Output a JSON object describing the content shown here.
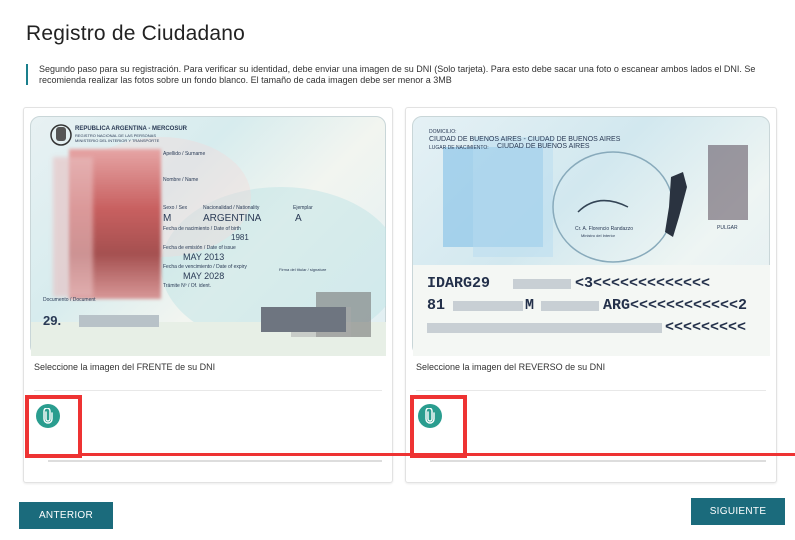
{
  "page": {
    "title": "Registro de Ciudadano",
    "info": "Segundo paso para su registración. Para verificar su identidad, debe enviar una imagen de su DNI (Solo tarjeta). Para esto debe sacar una foto o escanear ambos lados el DNI. Se recomienda realizar las fotos sobre un fondo blanco. El tamaño de cada imagen debe ser menor a 3MB"
  },
  "front_card": {
    "label": "Seleccione la imagen del FRENTE de su DNI",
    "attach_icon": "paperclip-icon",
    "id": {
      "header1": "REPUBLICA ARGENTINA - MERCOSUR",
      "header2": "REGISTRO NACIONAL DE LAS PERSONAS",
      "header3": "MINISTERIO DEL INTERIOR Y TRANSPORTE",
      "apellido_label": "Apellido / Surname",
      "nombre_label": "Nombre / Name",
      "sexo_label": "Sexo / Sex",
      "nacionalidad_label": "Nacionalidad / Nationality",
      "ejemplar_label": "Ejemplar",
      "sexo": "M",
      "nacionalidad": "ARGENTINA",
      "ejemplar": "A",
      "nacimiento_label": "Fecha de nacimiento / Date of birth",
      "nacimiento": "1981",
      "emision_label": "Fecha de emisión / Date of issue",
      "emision": "MAY 2013",
      "vencimiento_label": "Fecha de vencimiento / Date of expiry",
      "vencimiento": "MAY 2028",
      "tramite_label": "Trámite Nº / Of. ident.",
      "documento_label": "Documento / Document",
      "documento": "29.",
      "firma_label": "Firma del titular / signature"
    }
  },
  "back_card": {
    "label": "Seleccione la imagen del REVERSO de su DNI",
    "attach_icon": "paperclip-icon",
    "id": {
      "domicilio_label": "DOMICILIO:",
      "domicilio": "CIUDAD DE BUENOS AIRES - CIUDAD DE BUENOS AIRES",
      "nacimiento_label": "LUGAR DE NACIMIENTO:",
      "nacimiento": "CIUDAD DE BUENOS AIRES",
      "official": "Cr. A. Florencio Randazzo",
      "official_title": "Ministro del Interior",
      "pulgar": "PULGAR",
      "mrz1a": "IDARG29",
      "mrz1b": "<3<<<<<<<<<<<<<",
      "mrz2a": "81",
      "mrz2b": "M",
      "mrz2c": "ARG<<<<<<<<<<<<2",
      "mrz3": "<<<<<<<<<"
    }
  },
  "buttons": {
    "prev": "ANTERIOR",
    "next": "SIGUIENTE"
  },
  "colors": {
    "accent": "#1b6b7c",
    "attach": "#2a9d8f",
    "highlight": "#ee3333"
  }
}
